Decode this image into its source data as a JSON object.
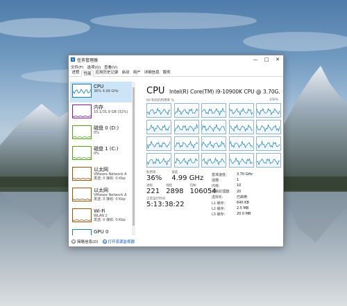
{
  "window": {
    "title": "任务管理器",
    "controls": [
      "—",
      "□",
      "✕"
    ]
  },
  "menu": [
    "文件(F)",
    "选项(O)",
    "查看(V)"
  ],
  "tabs": [
    "进程",
    "性能",
    "应用历史记录",
    "启动",
    "用户",
    "详细信息",
    "服务"
  ],
  "active_tab": "性能",
  "sidebar": {
    "items": [
      {
        "title": "CPU",
        "sub1": "36% 4.99 GHz",
        "sub2": "",
        "color": "#117dbb",
        "selected": true
      },
      {
        "title": "内存",
        "sub1": "10.1/31.9 GB (32%)",
        "sub2": "",
        "color": "#8b12ae",
        "selected": false
      },
      {
        "title": "磁盘 0 (D:)",
        "sub1": "0%",
        "sub2": "",
        "color": "#4da60c",
        "selected": false
      },
      {
        "title": "磁盘 1 (C:)",
        "sub1": "0%",
        "sub2": "",
        "color": "#4da60c",
        "selected": false
      },
      {
        "title": "以太网",
        "sub1": "VMware Network A",
        "sub2": "发送: 0 接收: 0 Kbp",
        "color": "#a74f01",
        "selected": false
      },
      {
        "title": "以太网",
        "sub1": "VMware Network A",
        "sub2": "发送: 0 接收: 0 Kbp",
        "color": "#a74f01",
        "selected": false
      },
      {
        "title": "Wi-Fi",
        "sub1": "WLAN 2",
        "sub2": "发送: 0 接收: 0 Kbp",
        "color": "#a74f01",
        "selected": false
      },
      {
        "title": "GPU 0",
        "sub1": "",
        "sub2": "",
        "color": "#117dbb",
        "selected": false
      }
    ]
  },
  "main": {
    "title": "CPU",
    "model": "Intel(R) Core(TM) i9-10900K CPU @ 3.70G...",
    "graph_label": "60 秒内的利用率 %",
    "graph_max": "100%",
    "stats": {
      "util_label": "利用率",
      "util_value": "36%",
      "speed_label": "速度",
      "speed_value": "4.99 GHz",
      "proc_label": "进程",
      "proc_value": "221",
      "thread_label": "线程",
      "thread_value": "2898",
      "handle_label": "句柄",
      "handle_value": "106054",
      "uptime_label": "正常运行时间",
      "uptime_value": "5:13:38:22"
    },
    "specs": [
      {
        "k": "基准速度:",
        "v": "3.70 GHz"
      },
      {
        "k": "插槽:",
        "v": "1"
      },
      {
        "k": "内核:",
        "v": "10"
      },
      {
        "k": "逻辑处理器:",
        "v": "20"
      },
      {
        "k": "虚拟化:",
        "v": "已启用"
      },
      {
        "k": "L1 缓存:",
        "v": "640 KB"
      },
      {
        "k": "L2 缓存:",
        "v": "2.5 MB"
      },
      {
        "k": "L3 缓存:",
        "v": "20.0 MB"
      }
    ]
  },
  "footer": {
    "fewer_details": "简略信息(D)",
    "open_monitor": "打开资源监视器"
  },
  "colors": {
    "cpu": "#117dbb",
    "memory": "#8b12ae",
    "disk": "#4da60c",
    "network": "#a74f01",
    "link": "#0b57b3",
    "selected_bg": "#cce4f7"
  }
}
